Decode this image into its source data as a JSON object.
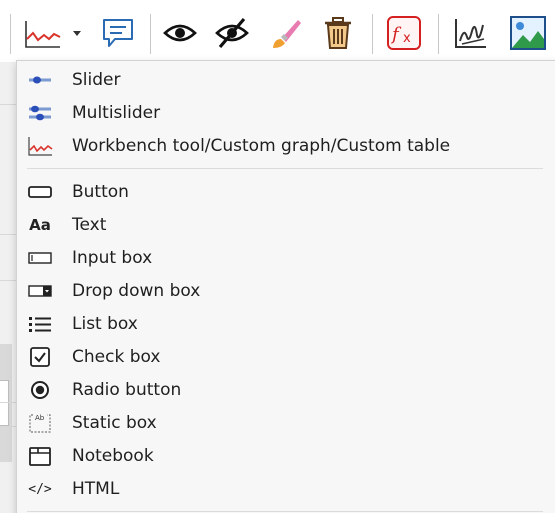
{
  "toolbar": {
    "buttons": [
      {
        "name": "graph-icon",
        "title": "Graph"
      },
      {
        "name": "comment-icon",
        "title": "Comment"
      },
      {
        "name": "eye-icon",
        "title": "Show"
      },
      {
        "name": "eye-hidden-icon",
        "title": "Hide"
      },
      {
        "name": "brush-icon",
        "title": "Brush"
      },
      {
        "name": "trash-icon",
        "title": "Delete"
      },
      {
        "name": "function-icon",
        "title": "Function"
      },
      {
        "name": "signature-icon",
        "title": "Signature"
      },
      {
        "name": "image-icon",
        "title": "Image"
      }
    ]
  },
  "menu": {
    "group1": [
      {
        "id": "slider",
        "label": "Slider",
        "icon": "slider-icon"
      },
      {
        "id": "multislider",
        "label": "Multislider",
        "icon": "multislider-icon"
      },
      {
        "id": "workbench",
        "label": "Workbench tool/Custom graph/Custom table",
        "icon": "graph-icon"
      }
    ],
    "group2": [
      {
        "id": "button",
        "label": "Button",
        "icon": "button-icon"
      },
      {
        "id": "text",
        "label": "Text",
        "icon": "text-icon",
        "glyph": "Aa"
      },
      {
        "id": "input",
        "label": "Input box",
        "icon": "input-box-icon"
      },
      {
        "id": "dropdown",
        "label": "Drop down box",
        "icon": "drop-down-box-icon"
      },
      {
        "id": "listbox",
        "label": "List box",
        "icon": "list-box-icon"
      },
      {
        "id": "checkbox",
        "label": "Check box",
        "icon": "check-box-icon"
      },
      {
        "id": "radio",
        "label": "Radio button",
        "icon": "radio-button-icon"
      },
      {
        "id": "static",
        "label": "Static box",
        "icon": "static-box-icon",
        "glyph": "Ab"
      },
      {
        "id": "notebook",
        "label": "Notebook",
        "icon": "notebook-icon"
      },
      {
        "id": "html",
        "label": "HTML",
        "icon": "html-icon",
        "glyph": "</>"
      }
    ]
  },
  "colors": {
    "graph_red": "#d9342b",
    "slider_blue": "#2b4fb8",
    "brush_orange": "#f0a030",
    "brush_pink": "#e87bb0",
    "function_red": "#d42020",
    "text": "#1f1f1f"
  }
}
